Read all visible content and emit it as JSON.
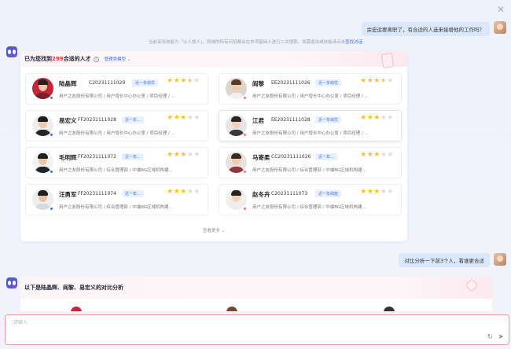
{
  "colors": {
    "accent": "#3d72e0",
    "count": "#e4392e",
    "star": "#f6c325",
    "input_border": "#ef9aa3"
  },
  "close_icon": "close-icon",
  "user_message_1": "余宏运要离职了，有合适的人选来接替他的工作吗？",
  "notice_text": "当前采用技能为「以人找人」，阳候的所有问招都会在本项基础上进行二次搜索。如需退出或技能请点击",
  "notice_link": "查找对话",
  "result_panel": {
    "title_prefix": "已为您找到",
    "count": "299",
    "title_suffix": "合适的人才",
    "manage_label": "管理类模型",
    "more_label": "查看更多"
  },
  "candidates": [
    {
      "name": "陆晶辉",
      "code": "C20231111029",
      "tag": "近一年绩优",
      "rating": 3.5,
      "subtitle": "用户之友股份有限公司 / 用户增长中心办公室 / 项目经理 / ...",
      "gender": "male"
    },
    {
      "name": "阎黎",
      "code": "EE20231111026",
      "tag": "近一年绩优",
      "rating": 3.5,
      "subtitle": "用户之友股份有限公司 / 用户增长中心办公室 / 项目经理 / ...",
      "gender": "female"
    },
    {
      "name": "易宏义",
      "code": "FF20231111028",
      "tag": "近一年...",
      "rating": 3,
      "subtitle": "用户之友股份有限公司 / 用户增长中心办公室 / 项目经理 / ...",
      "gender": "male"
    },
    {
      "name": "江君",
      "code": "EE20231111028",
      "tag": "近一年绩优",
      "rating": 3,
      "subtitle": "用户之友股份有限公司 / 用户增长中心办公室 / 项目经理 / ...",
      "gender": "female"
    },
    {
      "name": "毛明辉",
      "code": "FF20231111072",
      "tag": "近一年...",
      "rating": 3,
      "subtitle": "用户之友股份有限公司 / 综合管理部 / 中端BG区域机构建...",
      "gender": "male"
    },
    {
      "name": "马寄柔",
      "code": "CC20231111026",
      "tag": "近一年...",
      "rating": 3,
      "subtitle": "用户之友股份有限公司 / 综合管理部 / 中端BG区域机构建...",
      "gender": "female"
    },
    {
      "name": "汪勇军",
      "code": "FF20231111074",
      "tag": "近一年...",
      "rating": 3,
      "subtitle": "用户之友股份有限公司 / 综合管理部 / 中端BG区域机构建...",
      "gender": "male"
    },
    {
      "name": "赵冬卉",
      "code": "C20231111073",
      "tag": "近一年绩能",
      "rating": 3,
      "subtitle": "用户之友股份有限公司 / 综合管理部 / 中端BG区域机构建...",
      "gender": "female"
    }
  ],
  "user_message_2": "对比分析一下前3个人，看谁更合适",
  "compare_panel": {
    "title": "以下是陆晶辉、阎黎、易宏义的对比分析"
  },
  "input": {
    "placeholder": "|请输入",
    "value": ""
  },
  "input_icons": {
    "refresh": "refresh-icon",
    "send": "send-icon"
  }
}
